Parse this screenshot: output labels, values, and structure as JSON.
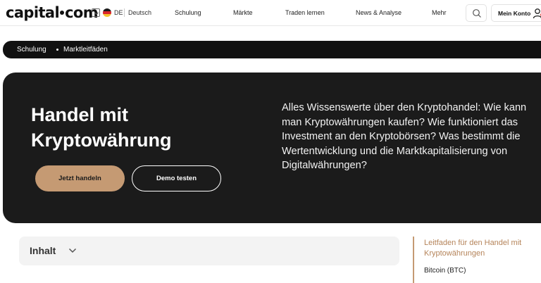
{
  "header": {
    "logo": {
      "left": "capital",
      "right": "com"
    },
    "language": {
      "code": "DE",
      "name": "Deutsch"
    },
    "nav": [
      "Schulung",
      "Märkte",
      "Traden lernen",
      "News & Analyse",
      "Mehr"
    ],
    "account_label": "Mein Konto"
  },
  "breadcrumb": [
    "Schulung",
    "Marktleitfäden"
  ],
  "hero": {
    "title": "Handel mit Kryptowährung",
    "description": "Alles Wissenswerte über den Kryptohandel: Wie kann man Kryptowährungen kaufen? Wie funktioniert das Investment an den Kryptobörsen? Was bestimmt die Wertentwicklung und die Marktkapitalisierung von Digitalwährungen?",
    "primary_button": "Jetzt handeln",
    "secondary_button": "Demo testen"
  },
  "toc": {
    "label": "Inhalt"
  },
  "sidebar": {
    "active_item": "Leitfaden für den Handel mit Kryptowährungen",
    "items": [
      "Bitcoin (BTC)"
    ]
  },
  "colors": {
    "accent": "#c59a73",
    "hero_bg": "#1b1b1b",
    "breadcrumb_bg": "#111111"
  }
}
